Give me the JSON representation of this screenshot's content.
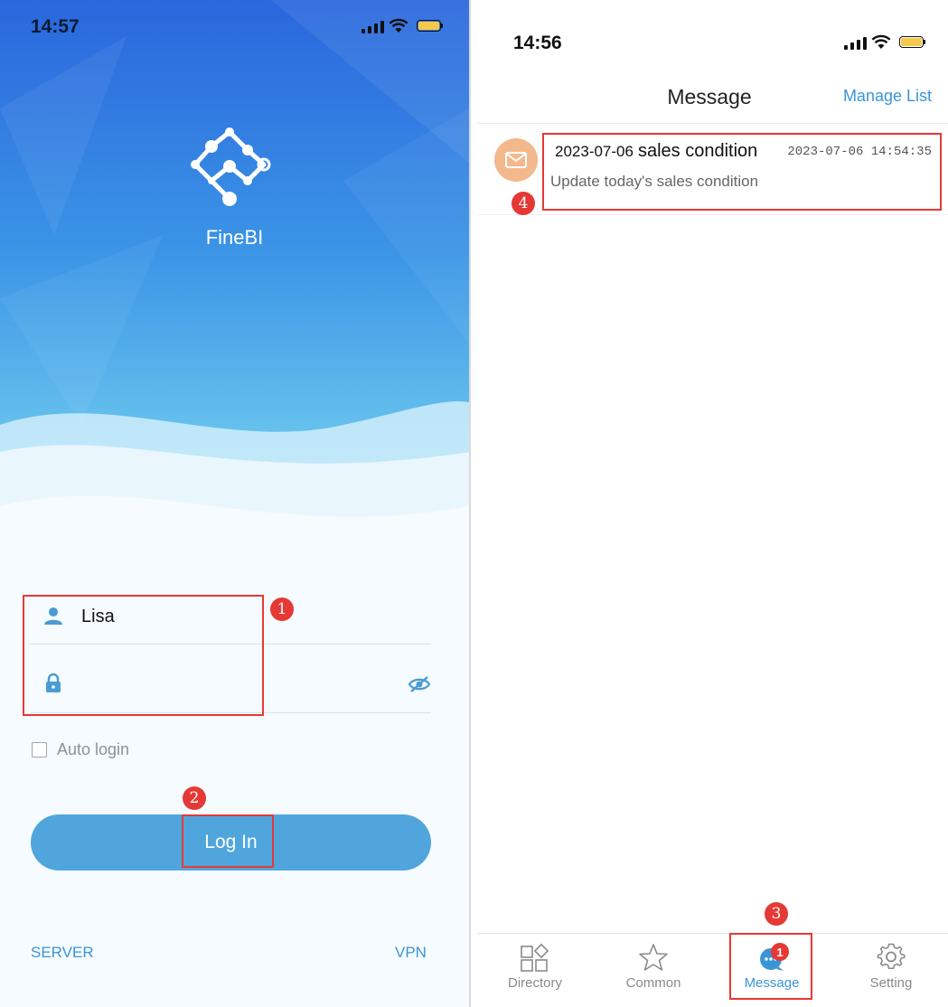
{
  "left": {
    "status_bar": {
      "time": "14:57"
    },
    "app_name": "FineBI",
    "login": {
      "username": "Lisa",
      "auto_login_label": "Auto login",
      "login_button": "Log In",
      "server_link": "SERVER",
      "vpn_link": "VPN"
    }
  },
  "right": {
    "status_bar": {
      "time": "14:56"
    },
    "nav": {
      "title": "Message",
      "manage_list": "Manage List"
    },
    "messages": [
      {
        "title_date": "2023-07-06",
        "title": "sales condition",
        "time": "2023-07-06 14:54:35",
        "body": "Update today's sales condition"
      }
    ],
    "tabs": [
      {
        "label": "Directory",
        "icon": "directory-icon",
        "active": false
      },
      {
        "label": "Common",
        "icon": "star-icon",
        "active": false
      },
      {
        "label": "Message",
        "icon": "message-icon",
        "active": true,
        "badge": "1"
      },
      {
        "label": "Setting",
        "icon": "gear-icon",
        "active": false
      }
    ]
  },
  "annotations": [
    "1",
    "2",
    "3",
    "4"
  ],
  "colors": {
    "accent": "#50a6dc",
    "highlight": "#e53935",
    "link": "#3a95d5"
  }
}
